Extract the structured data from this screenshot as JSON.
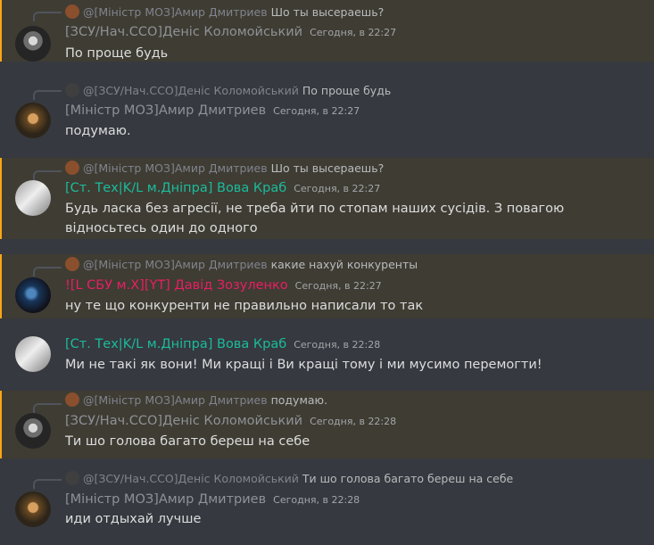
{
  "colors": {
    "background": "#36393f",
    "mention_highlight": "#3f3c33",
    "mention_bar": "#faa61a",
    "text": "#dcddde",
    "muted_name": "#8e9297",
    "green_name": "#1abc9c",
    "red_name": "#e91e63"
  },
  "messages": [
    {
      "reply": {
        "name": "@[Міністр МОЗ]Амир Дмитриев",
        "text": "Шо ты высераешь?"
      },
      "author": "[ЗСУ/Нач.ССО]Деніс Коломойський",
      "timestamp": "Сегодня, в 22:27",
      "content": "По проще будь"
    },
    {
      "reply": {
        "name": "@[ЗСУ/Нач.ССО]Деніс Коломойський",
        "text": "По проще будь"
      },
      "author": "[Міністр МОЗ]Амир Дмитриев",
      "timestamp": "Сегодня, в 22:27",
      "content": "подумаю."
    },
    {
      "reply": {
        "name": "@[Міністр МОЗ]Амир Дмитриев",
        "text": "Шо ты высераешь?"
      },
      "author": "[Ст. Тех|K/L м.Дніпра] Вова Краб",
      "timestamp": "Сегодня, в 22:27",
      "content": "Будь ласка без агресії, не треба йти по стопам наших сусідів. З повагою відносьтесь один до одного"
    },
    {
      "reply": {
        "name": "@[Міністр МОЗ]Амир Дмитриев",
        "text": "какие нахуй конкуренты"
      },
      "author": "![L СБУ м.Х][YT] Давід Зозуленко",
      "timestamp": "Сегодня, в 22:27",
      "content": "ну те що конкуренти не правильно написали то так"
    },
    {
      "author": "[Ст. Тех|K/L м.Дніпра] Вова Краб",
      "timestamp": "Сегодня, в 22:28",
      "content": "Ми не такі як вони! Ми кращі і Ви кращі тому і ми мусимо перемогти!"
    },
    {
      "reply": {
        "name": "@[Міністр МОЗ]Амир Дмитриев",
        "text": "подумаю."
      },
      "author": "[ЗСУ/Нач.ССО]Деніс Коломойський",
      "timestamp": "Сегодня, в 22:28",
      "content": "Ти шо голова багато береш на себе"
    },
    {
      "reply": {
        "name": "@[ЗСУ/Нач.ССО]Деніс Коломойський",
        "text": "Ти шо голова багато береш на себе"
      },
      "author": "[Міністр МОЗ]Амир Дмитриев",
      "timestamp": "Сегодня, в 22:28",
      "content": "иди отдыхай лучше"
    }
  ]
}
